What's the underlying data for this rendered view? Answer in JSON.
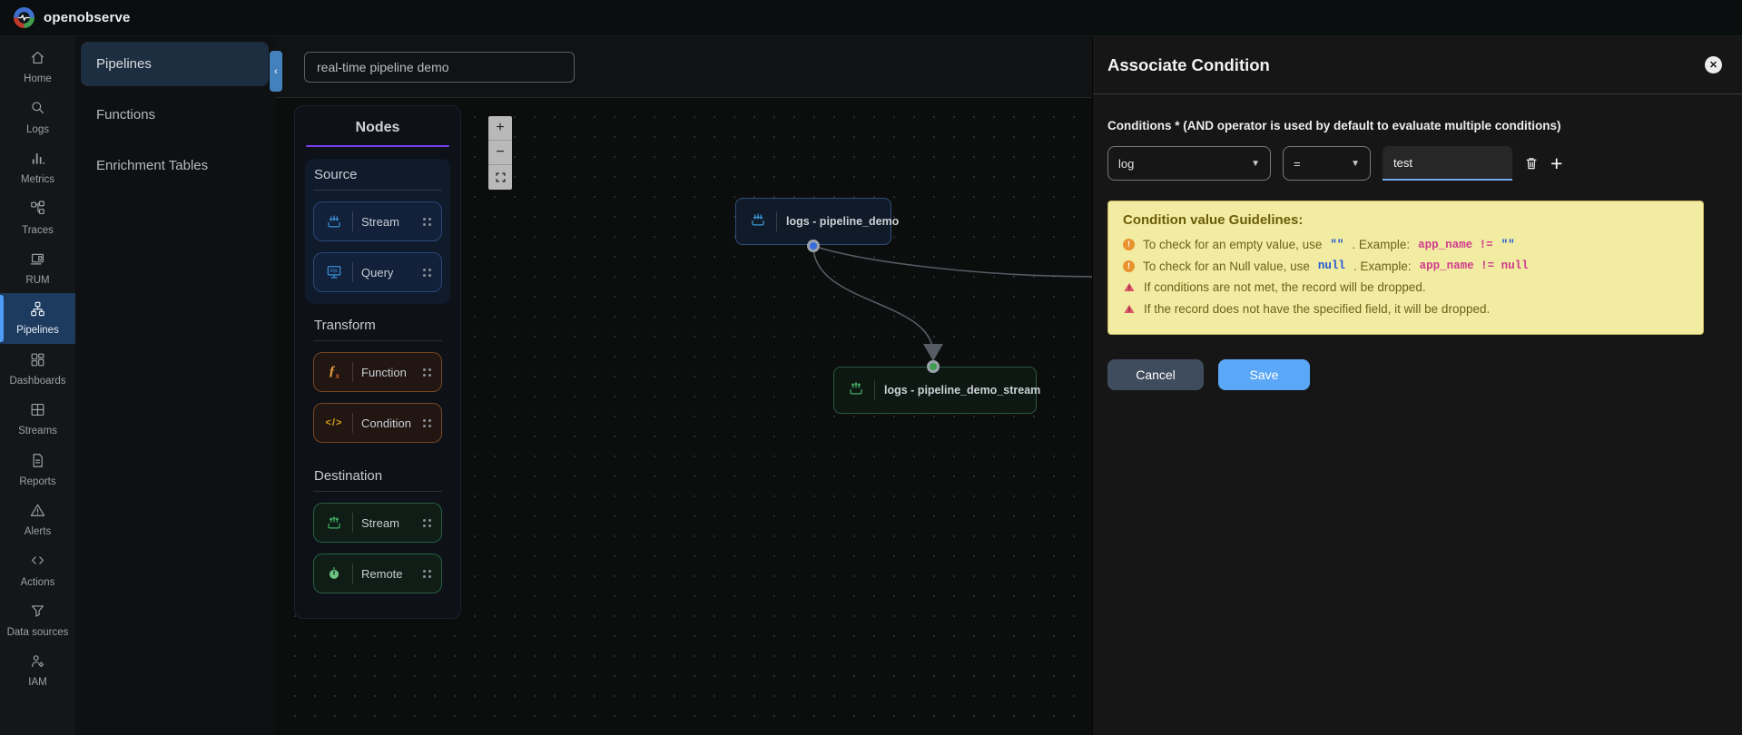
{
  "header": {
    "brand": "openobserve"
  },
  "sidebar": {
    "items": [
      {
        "label": "Home",
        "icon": "home"
      },
      {
        "label": "Logs",
        "icon": "logs"
      },
      {
        "label": "Metrics",
        "icon": "metrics"
      },
      {
        "label": "Traces",
        "icon": "traces"
      },
      {
        "label": "RUM",
        "icon": "rum"
      },
      {
        "label": "Pipelines",
        "icon": "pipelines",
        "active": true
      },
      {
        "label": "Dashboards",
        "icon": "dashboards"
      },
      {
        "label": "Streams",
        "icon": "streams"
      },
      {
        "label": "Reports",
        "icon": "reports"
      },
      {
        "label": "Alerts",
        "icon": "alerts"
      },
      {
        "label": "Actions",
        "icon": "actions"
      },
      {
        "label": "Data sources",
        "icon": "data-sources"
      },
      {
        "label": "IAM",
        "icon": "iam"
      }
    ]
  },
  "subnav": {
    "items": [
      {
        "label": "Pipelines",
        "active": true
      },
      {
        "label": "Functions",
        "active": false
      },
      {
        "label": "Enrichment Tables",
        "active": false
      }
    ]
  },
  "toolbar": {
    "pipeline_name": "real-time pipeline demo",
    "collapse_glyph": "‹"
  },
  "nodes_panel": {
    "title": "Nodes",
    "groups": [
      {
        "name": "Source",
        "tone": "source",
        "items": [
          {
            "label": "Stream",
            "icon": "stream-in"
          },
          {
            "label": "Query",
            "icon": "query"
          }
        ]
      },
      {
        "name": "Transform",
        "tone": "transform",
        "items": [
          {
            "label": "Function",
            "icon": "function"
          },
          {
            "label": "Condition",
            "icon": "condition"
          }
        ]
      },
      {
        "name": "Destination",
        "tone": "destination",
        "items": [
          {
            "label": "Stream",
            "icon": "stream-out"
          },
          {
            "label": "Remote",
            "icon": "remote"
          }
        ]
      }
    ]
  },
  "canvas": {
    "zoom_in": "+",
    "zoom_out": "−",
    "nodes": [
      {
        "label": "logs - pipeline_demo",
        "type": "source"
      },
      {
        "label": "logs - pipeline_demo_stream",
        "type": "destination"
      }
    ]
  },
  "dialog": {
    "title": "Associate Condition",
    "close_glyph": "✕",
    "conditions_label": "Conditions * (AND operator is used by default to evaluate multiple conditions)",
    "row": {
      "column": "log",
      "operator": "=",
      "value": "test"
    },
    "guidelines": {
      "title": "Condition value Guidelines:",
      "items": [
        {
          "icon": "error",
          "parts": [
            {
              "t": "To check for an empty value, use "
            },
            {
              "t": "\"\"",
              "c": "blue"
            },
            {
              "t": ". Example: "
            },
            {
              "t": "app_name != ",
              "c": "pink"
            },
            {
              "t": "\"\"",
              "c": "blue"
            }
          ]
        },
        {
          "icon": "error",
          "parts": [
            {
              "t": "To check for an Null value, use "
            },
            {
              "t": "null",
              "c": "blue"
            },
            {
              "t": ". Example: "
            },
            {
              "t": "app_name != null",
              "c": "pink"
            }
          ]
        },
        {
          "icon": "warning",
          "parts": [
            {
              "t": "If conditions are not met, the record will be dropped."
            }
          ]
        },
        {
          "icon": "warning",
          "parts": [
            {
              "t": "If the record does not have the specified field, it will be dropped."
            }
          ]
        }
      ]
    },
    "cancel_label": "Cancel",
    "save_label": "Save",
    "colors": {
      "accent_blue": "#5ba7f7",
      "guideline_bg": "#f2eca2",
      "error_orange": "#e8922e",
      "warning_red": "#db5666",
      "code_blue": "#2257d6",
      "code_pink": "#cf3a8e"
    }
  }
}
